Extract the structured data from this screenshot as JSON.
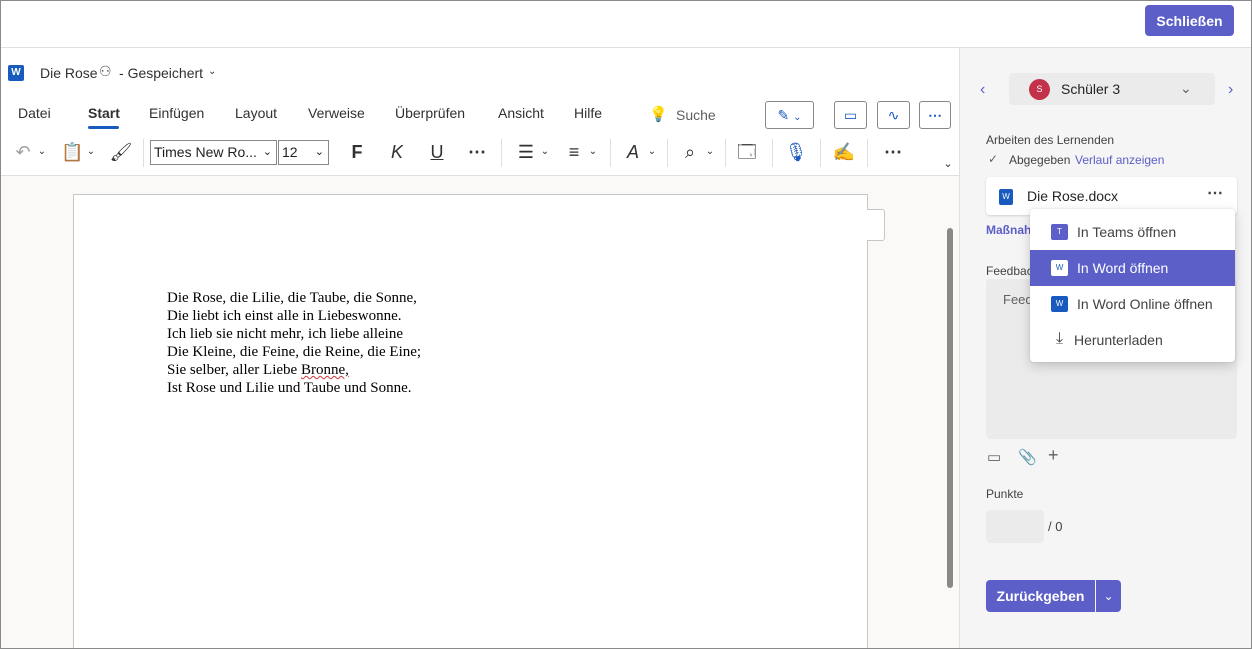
{
  "topbar": {
    "close_label": "Schließen"
  },
  "word": {
    "logo": "W",
    "doc_title": "Die Rose",
    "saved_state": "Gespeichert",
    "tabs": [
      "Datei",
      "Start",
      "Einfügen",
      "Layout",
      "Verweise",
      "Überprüfen",
      "Ansicht",
      "Hilfe"
    ],
    "active_tab": "Start",
    "search_label": "Suche",
    "font_name": "Times New Ro...",
    "font_size": "12",
    "bold_glyph": "F",
    "italic_glyph": "K",
    "underline_glyph": "U"
  },
  "document": {
    "lines": [
      "Die Rose, die Lilie, die Taube, die Sonne,",
      "Die liebt ich einst alle in Liebeswonne.",
      "Ich lieb sie nicht mehr, ich liebe alleine",
      "Die Kleine, die Feine, die Reine, die Eine;",
      "Sie selber, aller Liebe ",
      "Ist Rose und Lilie und Taube und Sonne."
    ],
    "misspelled_word": "Bronne,"
  },
  "panel": {
    "student_initial": "S",
    "student_name": "Schüler 3",
    "work_label": "Arbeiten des Lernenden",
    "submitted_label": "Abgegeben",
    "history_link": "Verlauf anzeigen",
    "file_name": "Die Rose.docx",
    "file_icon": "W",
    "rubric_link": "Maßnah",
    "feedback_label": "Feedbac",
    "feedback_placeholder": "Feed",
    "points_label": "Punkte",
    "points_max": "/ 0",
    "return_label": "Zurückgeben"
  },
  "dropdown": {
    "items": [
      {
        "label": "In Teams öffnen",
        "icon": "T"
      },
      {
        "label": "In Word öffnen",
        "icon": "W"
      },
      {
        "label": "In Word Online öffnen",
        "icon": "W"
      },
      {
        "label": "Herunterladen",
        "icon": "download-icon"
      }
    ],
    "selected_index": 1
  },
  "colors": {
    "accent": "#5b5fc7",
    "word_blue": "#185abd",
    "avatar": "#c4314b"
  }
}
